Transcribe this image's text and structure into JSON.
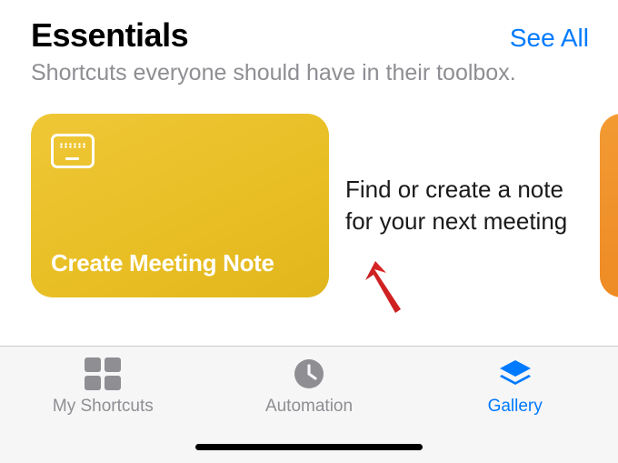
{
  "section": {
    "title": "Essentials",
    "subtitle": "Shortcuts everyone should have in their toolbox.",
    "see_all": "See All"
  },
  "card": {
    "icon": "keyboard-icon",
    "title": "Create Meeting Note",
    "description": "Find or create a note for your next meeting",
    "bg_color": "#e8be24"
  },
  "peek_card": {
    "bg_color": "#f09030"
  },
  "tabs": {
    "my_shortcuts": "My Shortcuts",
    "automation": "Automation",
    "gallery": "Gallery",
    "active": "gallery"
  },
  "colors": {
    "accent": "#007aff",
    "inactive": "#8e8e93"
  }
}
